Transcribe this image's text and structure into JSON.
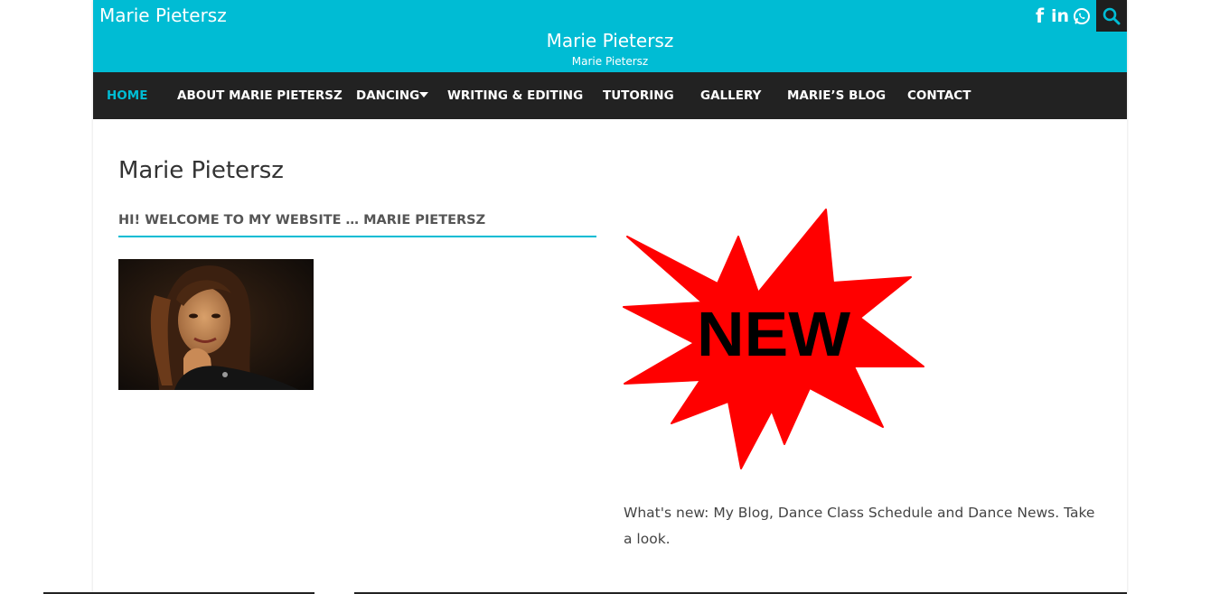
{
  "header": {
    "site_name": "Marie Pietersz",
    "title": "Marie Pietersz",
    "tagline": "Marie Pietersz",
    "social": {
      "facebook_glyph": "f",
      "linkedin_glyph": "in",
      "whatsapp_icon": "whatsapp-icon"
    },
    "search_icon": "search-icon",
    "bg_color": "#00bcd4"
  },
  "nav": {
    "items": [
      {
        "label": "HOME"
      },
      {
        "label": "ABOUT MARIE PIETERSZ"
      },
      {
        "label": "DANCING"
      },
      {
        "label": "WRITING & EDITING"
      },
      {
        "label": "TUTORING"
      },
      {
        "label": "GALLERY"
      },
      {
        "label": "MARIE’S BLOG"
      },
      {
        "label": "CONTACT"
      }
    ],
    "active": "HOME",
    "bg_color": "#222222",
    "active_color": "#00bcd4"
  },
  "main": {
    "page_title": "Marie Pietersz",
    "widget_heading": "HI! WELCOME TO MY WEBSITE … MARIE PIETERSZ",
    "badge_text": "NEW",
    "news_text": "What's new: My Blog, Dance Class Schedule and Dance News. Take a look."
  }
}
